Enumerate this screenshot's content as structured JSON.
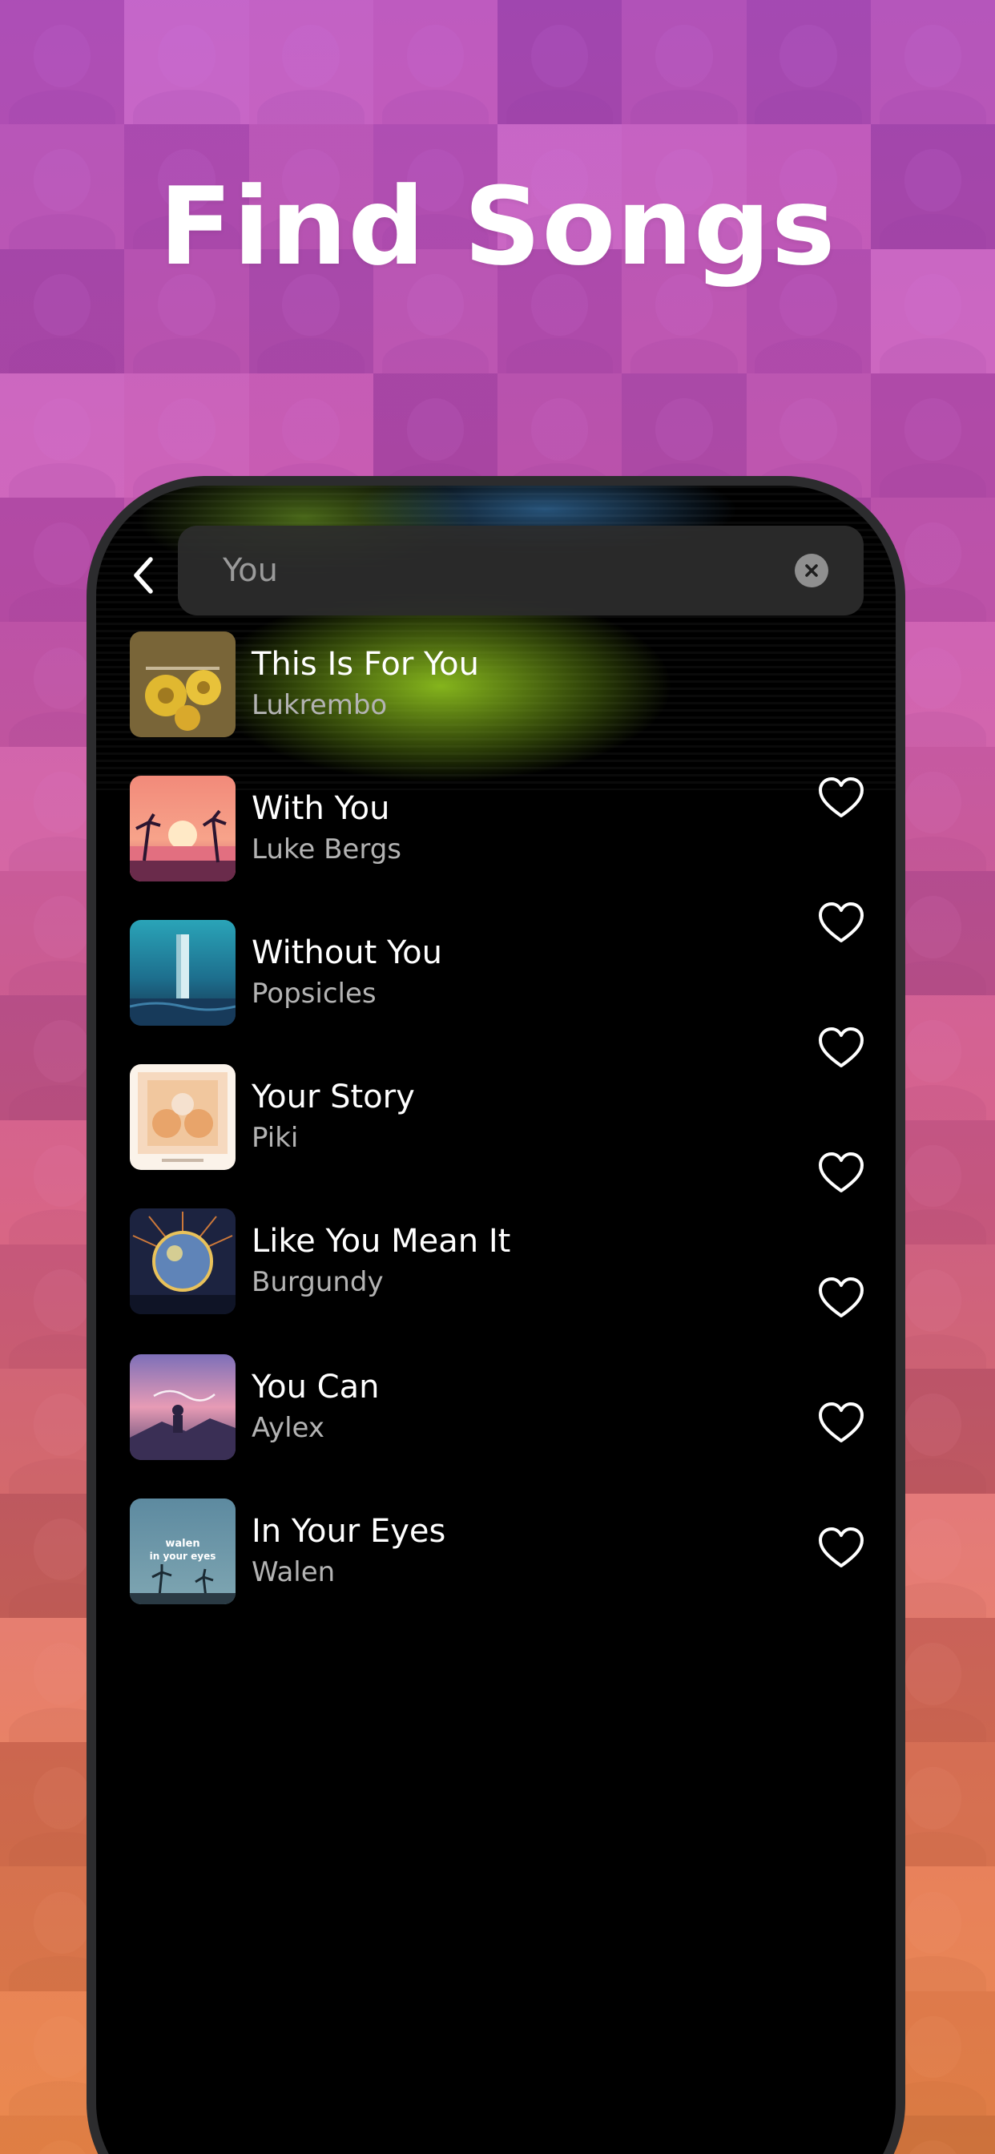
{
  "headline": "Find Songs",
  "colors": {
    "background_top": "#b94be0",
    "background_bottom": "#f0803c",
    "screen": "#000000",
    "search_field": "#2c2c2c",
    "accent_glow": "#8cbe1e",
    "text_primary": "#ffffff",
    "text_secondary": "#b3b3b3"
  },
  "search": {
    "value": "You",
    "back_icon": "chevron-left-icon",
    "clear_icon": "clear-circle-icon"
  },
  "songs": [
    {
      "title": "This Is For You",
      "artist": "Lukrembo",
      "cover_icon": "album-cover-yellow-flowers"
    },
    {
      "title": "With You",
      "artist": "Luke Bergs",
      "cover_icon": "album-cover-sunset-palms"
    },
    {
      "title": "Without You",
      "artist": "Popsicles",
      "cover_icon": "album-cover-monolith-sea"
    },
    {
      "title": "Your Story",
      "artist": "Piki",
      "cover_icon": "album-cover-illustration"
    },
    {
      "title": "Like You Mean It",
      "artist": "Burgundy",
      "cover_icon": "album-cover-disco-ball"
    },
    {
      "title": "You Can",
      "artist": "Aylex",
      "cover_icon": "album-cover-pink-sky"
    },
    {
      "title": "In Your Eyes",
      "artist": "Walen",
      "cover_icon": "album-cover-palm-trees",
      "cover_text": [
        "walen",
        "in your eyes"
      ]
    }
  ],
  "favorite_icon": "heart-outline-icon",
  "favorite_count": 7
}
